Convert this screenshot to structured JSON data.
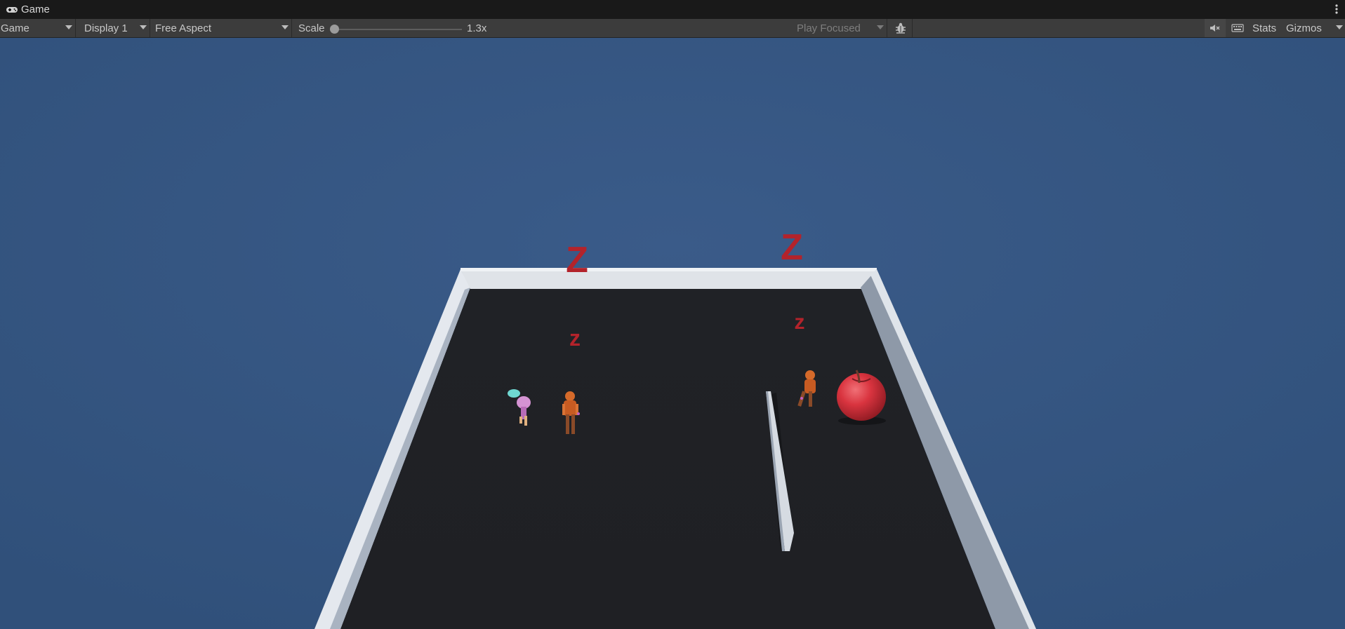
{
  "window": {
    "tab_title": "Game"
  },
  "toolbar": {
    "view_mode": "Game",
    "display": "Display 1",
    "aspect": "Free Aspect",
    "scale_label": "Scale",
    "scale_value": "1.3x",
    "scale_fraction": 0.0,
    "play_mode": "Play Focused",
    "stats_label": "Stats",
    "gizmos_label": "Gizmos"
  },
  "scene": {
    "sky_color": "#34527d",
    "floor_color": "#1f2125",
    "wall_color": "#dfe3e8",
    "sleep_markers": [
      "Z",
      "z",
      "Z",
      "z"
    ],
    "objects": [
      "pink-character",
      "orange-character-left",
      "orange-character-right",
      "thin-wall",
      "apple"
    ]
  }
}
